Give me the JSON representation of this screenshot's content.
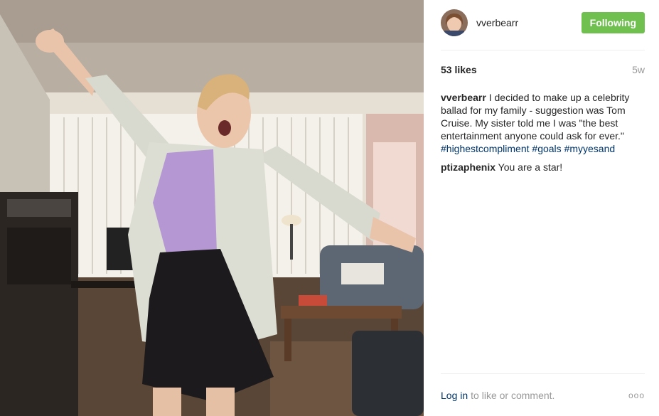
{
  "post": {
    "username": "vverbearr",
    "follow_label": "Following",
    "likes": "53 likes",
    "age": "5w",
    "caption": {
      "user": "vverbearr",
      "text": "I decided to make up a celebrity ballad for my family - suggestion was Tom Cruise. My sister told me I was \"the best entertainment anyone could ask for ever.\"",
      "hashtags": [
        "#highestcompliment",
        "#goals",
        "#myyesand"
      ]
    },
    "comments": [
      {
        "user": "ptizaphenix",
        "text": "You are a star!"
      }
    ],
    "footer": {
      "login": "Log in",
      "rest": "to like or comment.",
      "more": "ooo"
    }
  },
  "colors": {
    "follow_button": "#70c050",
    "hashtag": "#003569",
    "muted": "#999999"
  }
}
